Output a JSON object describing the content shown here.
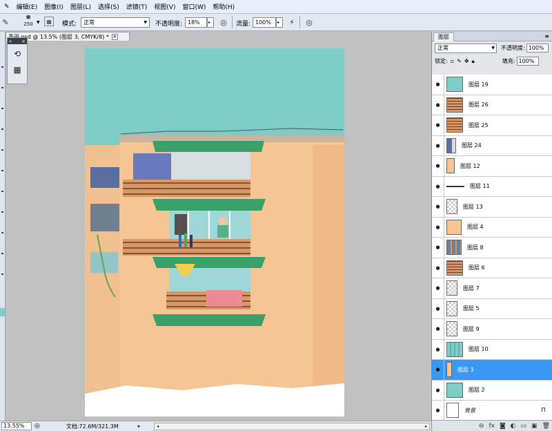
{
  "menu": [
    "编辑(E)",
    "图像(I)",
    "图层(L)",
    "选择(S)",
    "滤镜(T)",
    "视图(V)",
    "窗口(W)",
    "帮助(H)"
  ],
  "options": {
    "brush_size": "250",
    "mode_label": "模式:",
    "mode_value": "正常",
    "opacity_label": "不透明度:",
    "opacity_value": "18%",
    "flow_label": "流量:",
    "flow_value": "100%"
  },
  "document": {
    "tab_title": "圣诞.psd @ 13.5% (图层 3, CMYK/8) *",
    "close_glyph": "×"
  },
  "status": {
    "zoom": "13.55%",
    "doc_info": "文档:72.6M/321.3M"
  },
  "layers_panel": {
    "title": "图层",
    "blend_mode": "正常",
    "opacity_label": "不透明度:",
    "opacity_value": "100%",
    "lock_label": "锁定:",
    "fill_label": "填充:",
    "fill_value": "100%",
    "layers": [
      {
        "name": "图层 19",
        "thumb": "teal",
        "selected": false
      },
      {
        "name": "图层 26",
        "thumb": "balcony",
        "selected": false
      },
      {
        "name": "图层 25",
        "thumb": "balcony-check",
        "selected": false
      },
      {
        "name": "图层 24",
        "thumb": "window",
        "selected": false
      },
      {
        "name": "图层 12",
        "thumb": "peach-strip",
        "selected": false
      },
      {
        "name": "图层 11",
        "thumb": "line",
        "selected": false
      },
      {
        "name": "图层 13",
        "thumb": "checker",
        "selected": false
      },
      {
        "name": "图层 4",
        "thumb": "peach",
        "selected": false
      },
      {
        "name": "图层 8",
        "thumb": "windows",
        "selected": false
      },
      {
        "name": "图层 6",
        "thumb": "balcony",
        "selected": false
      },
      {
        "name": "图层 7",
        "thumb": "checker",
        "selected": false
      },
      {
        "name": "图层 5",
        "thumb": "checker",
        "selected": false
      },
      {
        "name": "图层 9",
        "thumb": "checker",
        "selected": false
      },
      {
        "name": "图层 10",
        "thumb": "teal-pattern",
        "selected": false
      },
      {
        "name": "图层 3",
        "thumb": "peach-thin",
        "selected": true
      },
      {
        "name": "图层 2",
        "thumb": "teal",
        "selected": false
      },
      {
        "name": "背景",
        "thumb": "white",
        "selected": false,
        "locked": true
      }
    ]
  },
  "colors": {
    "sky": "#7ecdc7",
    "wall": "#f6c594",
    "green_awning": "#3aa06a",
    "selected_layer": "#3a98f5"
  }
}
